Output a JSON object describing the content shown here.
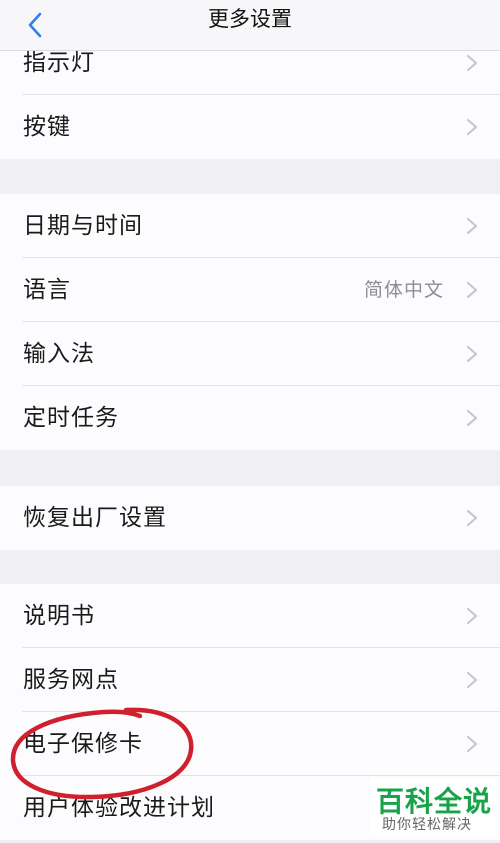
{
  "header": {
    "title": "更多设置",
    "back_icon": "chevron-left-icon",
    "accent_color": "#2f80ed"
  },
  "groups": [
    {
      "items": [
        {
          "label": "指示灯"
        },
        {
          "label": "按键"
        }
      ]
    },
    {
      "items": [
        {
          "label": "日期与时间"
        },
        {
          "label": "语言",
          "value": "简体中文"
        },
        {
          "label": "输入法"
        },
        {
          "label": "定时任务"
        }
      ]
    },
    {
      "items": [
        {
          "label": "恢复出厂设置"
        }
      ]
    },
    {
      "items": [
        {
          "label": "说明书"
        },
        {
          "label": "服务网点"
        },
        {
          "label": "电子保修卡"
        },
        {
          "label": "用户体验改进计划"
        }
      ]
    }
  ],
  "annotation": {
    "circled_item": "电子保修卡",
    "color": "#d0202e"
  },
  "watermark": {
    "title": "百科全说",
    "subtitle": "助你轻松解决",
    "color": "#16a34a"
  }
}
